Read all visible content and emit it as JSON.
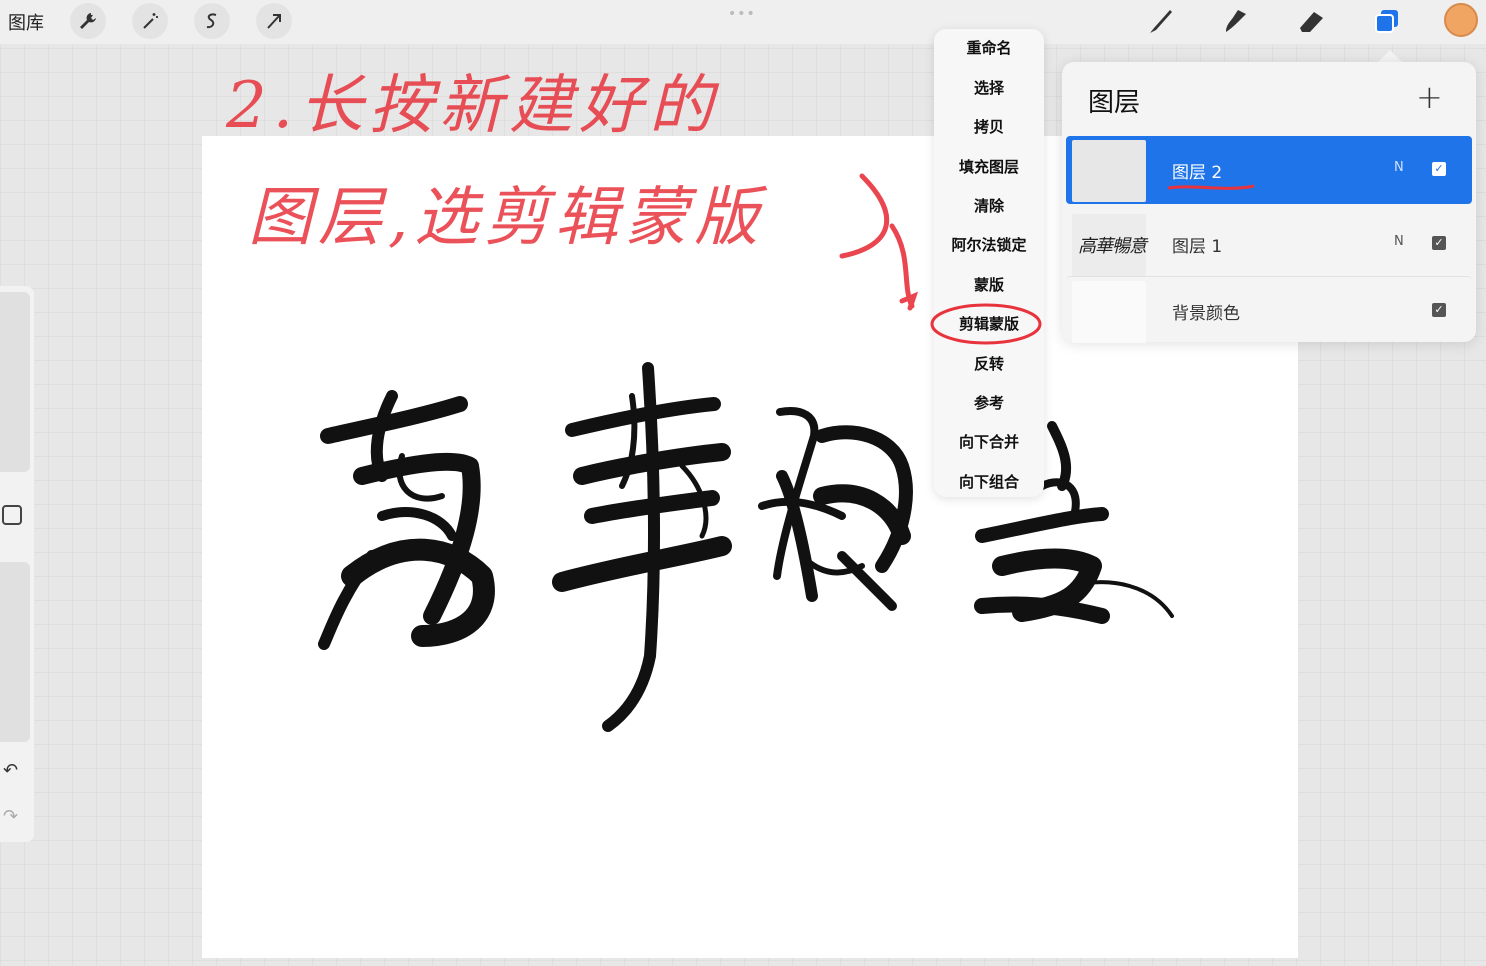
{
  "toolbar": {
    "gallery_label": "图库",
    "tools": [
      "wrench-icon",
      "magic-wand-icon",
      "selection-icon",
      "transform-arrow-icon"
    ],
    "right_tools": [
      "brush-icon",
      "smudge-icon",
      "eraser-icon",
      "layers-icon"
    ],
    "current_color": "#f0a562",
    "accent": "#1e74e8"
  },
  "context_menu": {
    "items": [
      "重命名",
      "选择",
      "拷贝",
      "填充图层",
      "清除",
      "阿尔法锁定",
      "蒙版",
      "剪辑蒙版",
      "反转",
      "参考",
      "向下合并",
      "向下组合"
    ],
    "highlighted": "剪辑蒙版"
  },
  "layers_panel": {
    "title": "图层",
    "add_label": "+",
    "layers": [
      {
        "name": "图层 2",
        "mode": "N",
        "visible": true,
        "selected": true
      },
      {
        "name": "图层 1",
        "mode": "N",
        "visible": true,
        "selected": false
      },
      {
        "name": "背景颜色",
        "mode": "",
        "visible": true,
        "selected": false
      }
    ],
    "layer1_thumb_text": "高華暢意"
  },
  "annotation": {
    "line1": "2.长按新建好的",
    "line2": "图层,选剪辑蒙版",
    "color": "#e8333c"
  },
  "canvas": {
    "calligraphy_text": "高華暢意"
  }
}
